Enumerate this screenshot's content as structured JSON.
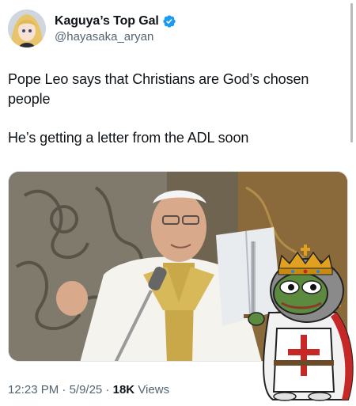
{
  "user": {
    "display_name": "Kaguya’s Top Gal",
    "handle": "@hayasaka_aryan",
    "verified": true
  },
  "tweet": {
    "paragraph_1": "Pope Leo says that Christians are God’s chosen people",
    "paragraph_2": "He’s getting a letter from the ADL soon"
  },
  "meta": {
    "time": "12:23 PM",
    "separator_1": " · ",
    "date": "5/9/25",
    "separator_2": " · ",
    "views_count": "18K",
    "views_label": " Views"
  },
  "icons": {
    "verified": "verified-badge-icon"
  },
  "colors": {
    "verified_blue": "#1d9bf0",
    "secondary_text": "#536471"
  }
}
